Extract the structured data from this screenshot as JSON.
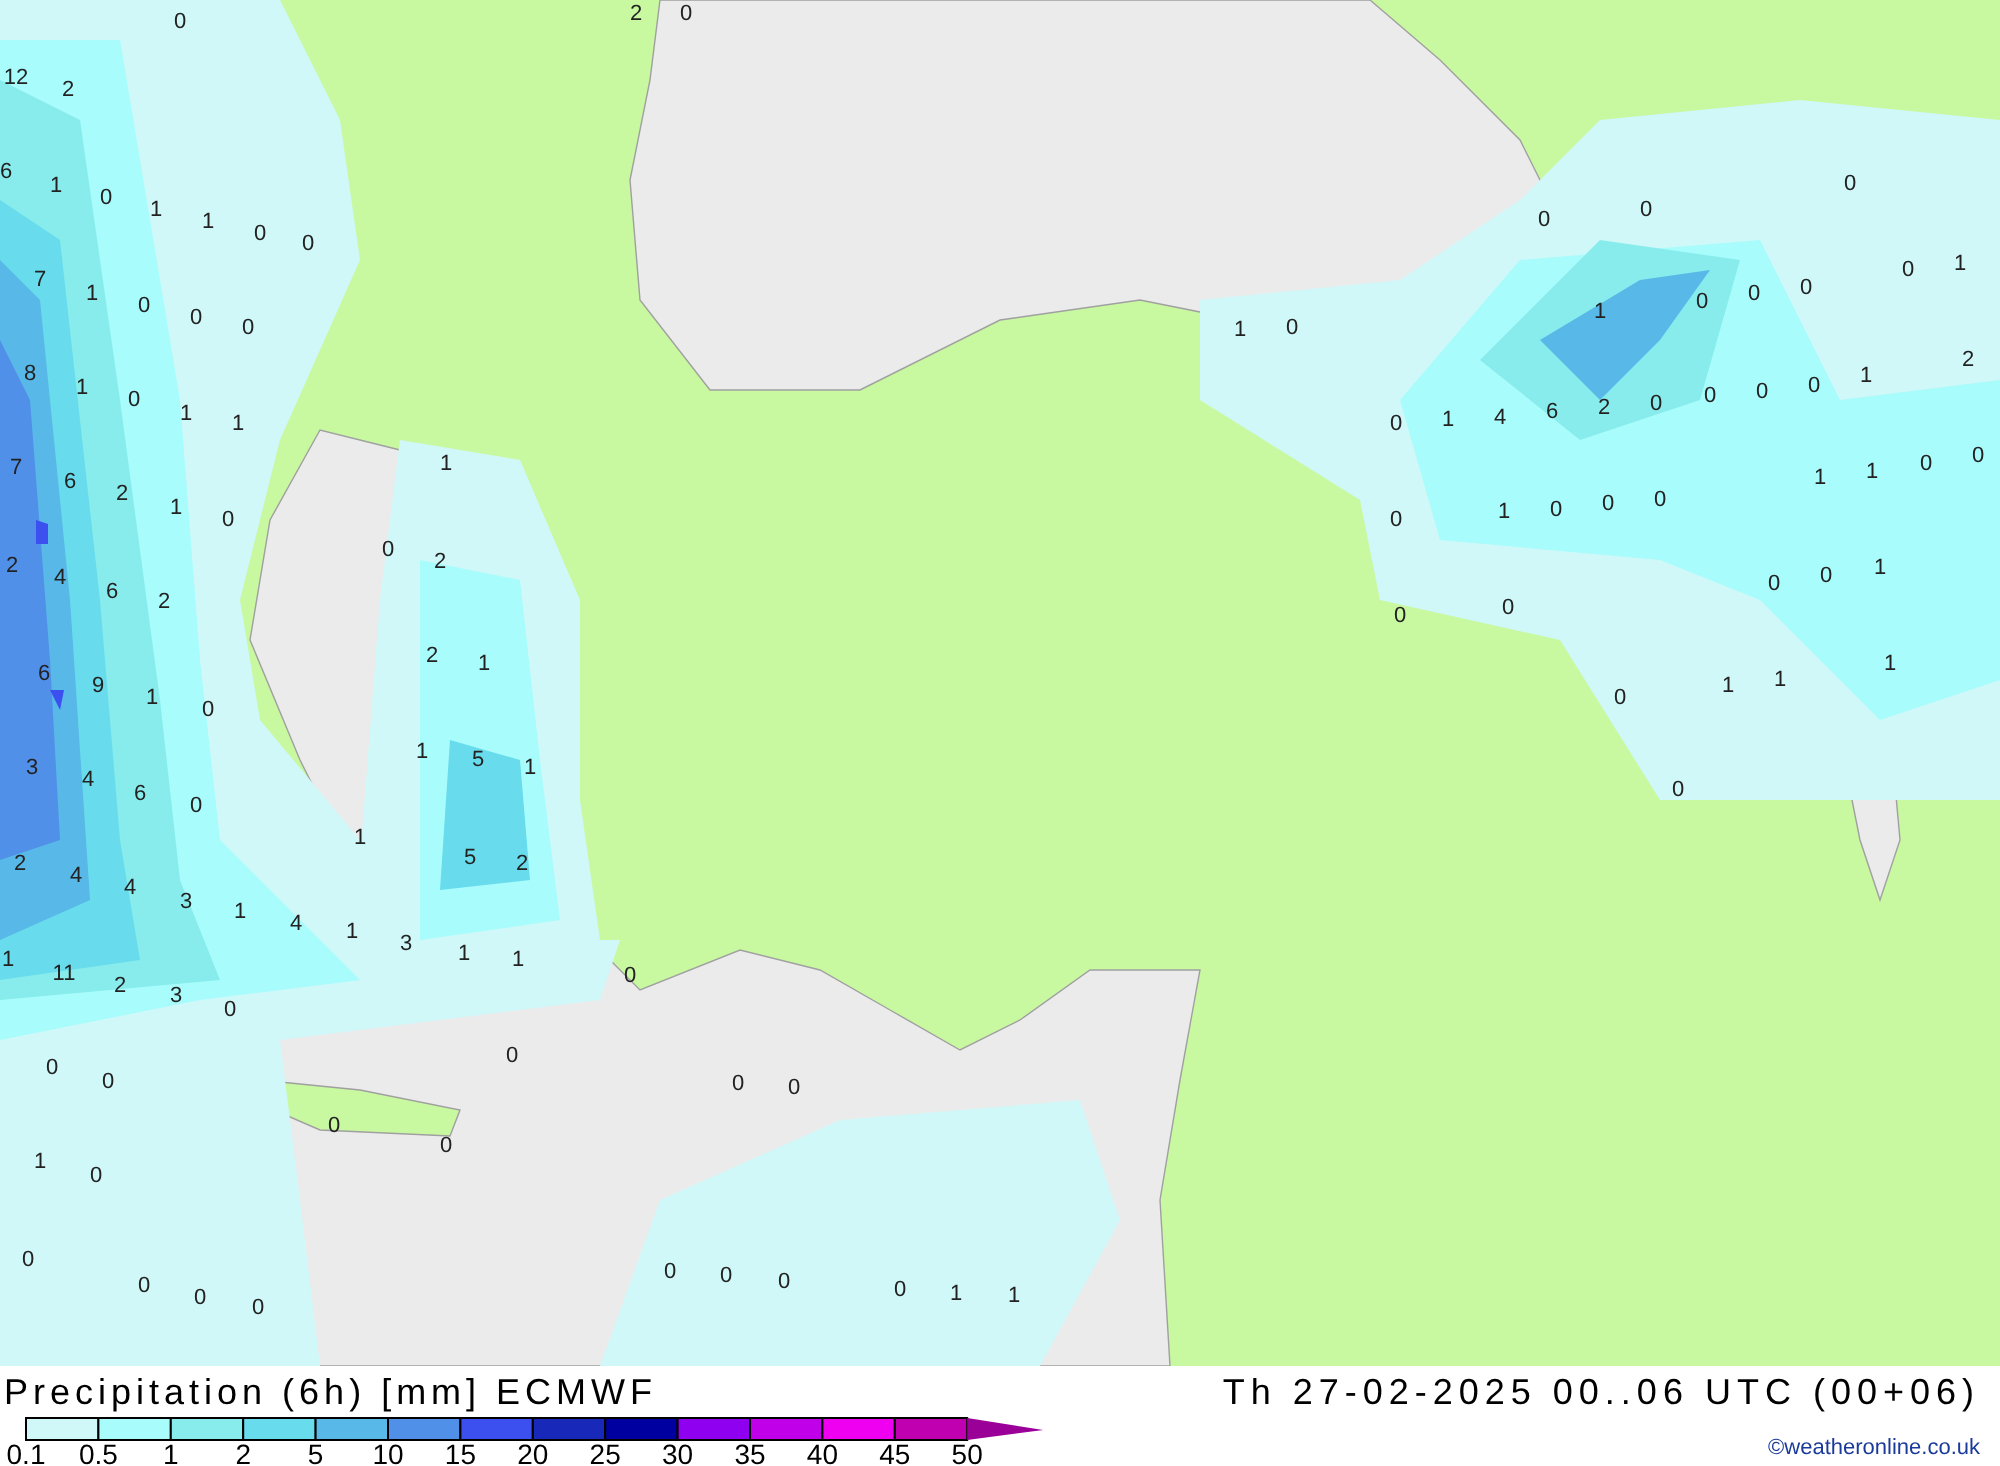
{
  "map": {
    "value_labels": [
      "0",
      "2",
      "0",
      "12",
      "2",
      "6",
      "1",
      "0",
      "1",
      "1",
      "0",
      "0",
      "0",
      "0",
      "0",
      "7",
      "1",
      "0",
      "0",
      "0",
      "0",
      "1",
      "0",
      "0",
      "0",
      "1",
      "0",
      "1",
      "8",
      "1",
      "0",
      "1",
      "1",
      "1",
      "2",
      "0",
      "1",
      "4",
      "6",
      "2",
      "0",
      "0",
      "0",
      "0",
      "7",
      "6",
      "2",
      "1",
      "0",
      "1",
      "1",
      "1",
      "0",
      "0",
      "0",
      "1",
      "0",
      "0",
      "0",
      "2",
      "4",
      "6",
      "2",
      "0",
      "2",
      "0",
      "0",
      "1",
      "0",
      "0",
      "6",
      "9",
      "1",
      "0",
      "2",
      "1",
      "1",
      "1",
      "1",
      "0",
      "3",
      "4",
      "6",
      "0",
      "1",
      "5",
      "1",
      "0",
      "2",
      "4",
      "4",
      "3",
      "1",
      "1",
      "5",
      "2",
      "1",
      "4",
      "1",
      "3",
      "1",
      "1",
      "11",
      "2",
      "3",
      "0",
      "0",
      "0",
      "0",
      "0",
      "0",
      "0",
      "0",
      "0",
      "1",
      "0",
      "0",
      "0",
      "0",
      "0",
      "0",
      "0",
      "0",
      "0",
      "1",
      "1"
    ]
  },
  "legend": {
    "title": "Precipitation (6h) [mm] ECMWF",
    "bins": [
      {
        "color": "#d0f8f8"
      },
      {
        "color": "#a8fcfc"
      },
      {
        "color": "#88ecec"
      },
      {
        "color": "#68dcec"
      },
      {
        "color": "#58b8e8"
      },
      {
        "color": "#5090e8"
      },
      {
        "color": "#3c50f0"
      },
      {
        "color": "#1828b8"
      },
      {
        "color": "#0000a0"
      },
      {
        "color": "#9000f0"
      },
      {
        "color": "#c000e8"
      },
      {
        "color": "#f000f0"
      },
      {
        "color": "#c000b0"
      }
    ],
    "overflow": {
      "color": "#9a0098"
    },
    "ticks": [
      "0.1",
      "0.5",
      "1",
      "2",
      "5",
      "10",
      "15",
      "20",
      "25",
      "30",
      "35",
      "40",
      "45",
      "50"
    ]
  },
  "valid_time": "Th 27-02-2025 00..06 UTC (00+06)",
  "credit": "©weatheronline.co.uk"
}
